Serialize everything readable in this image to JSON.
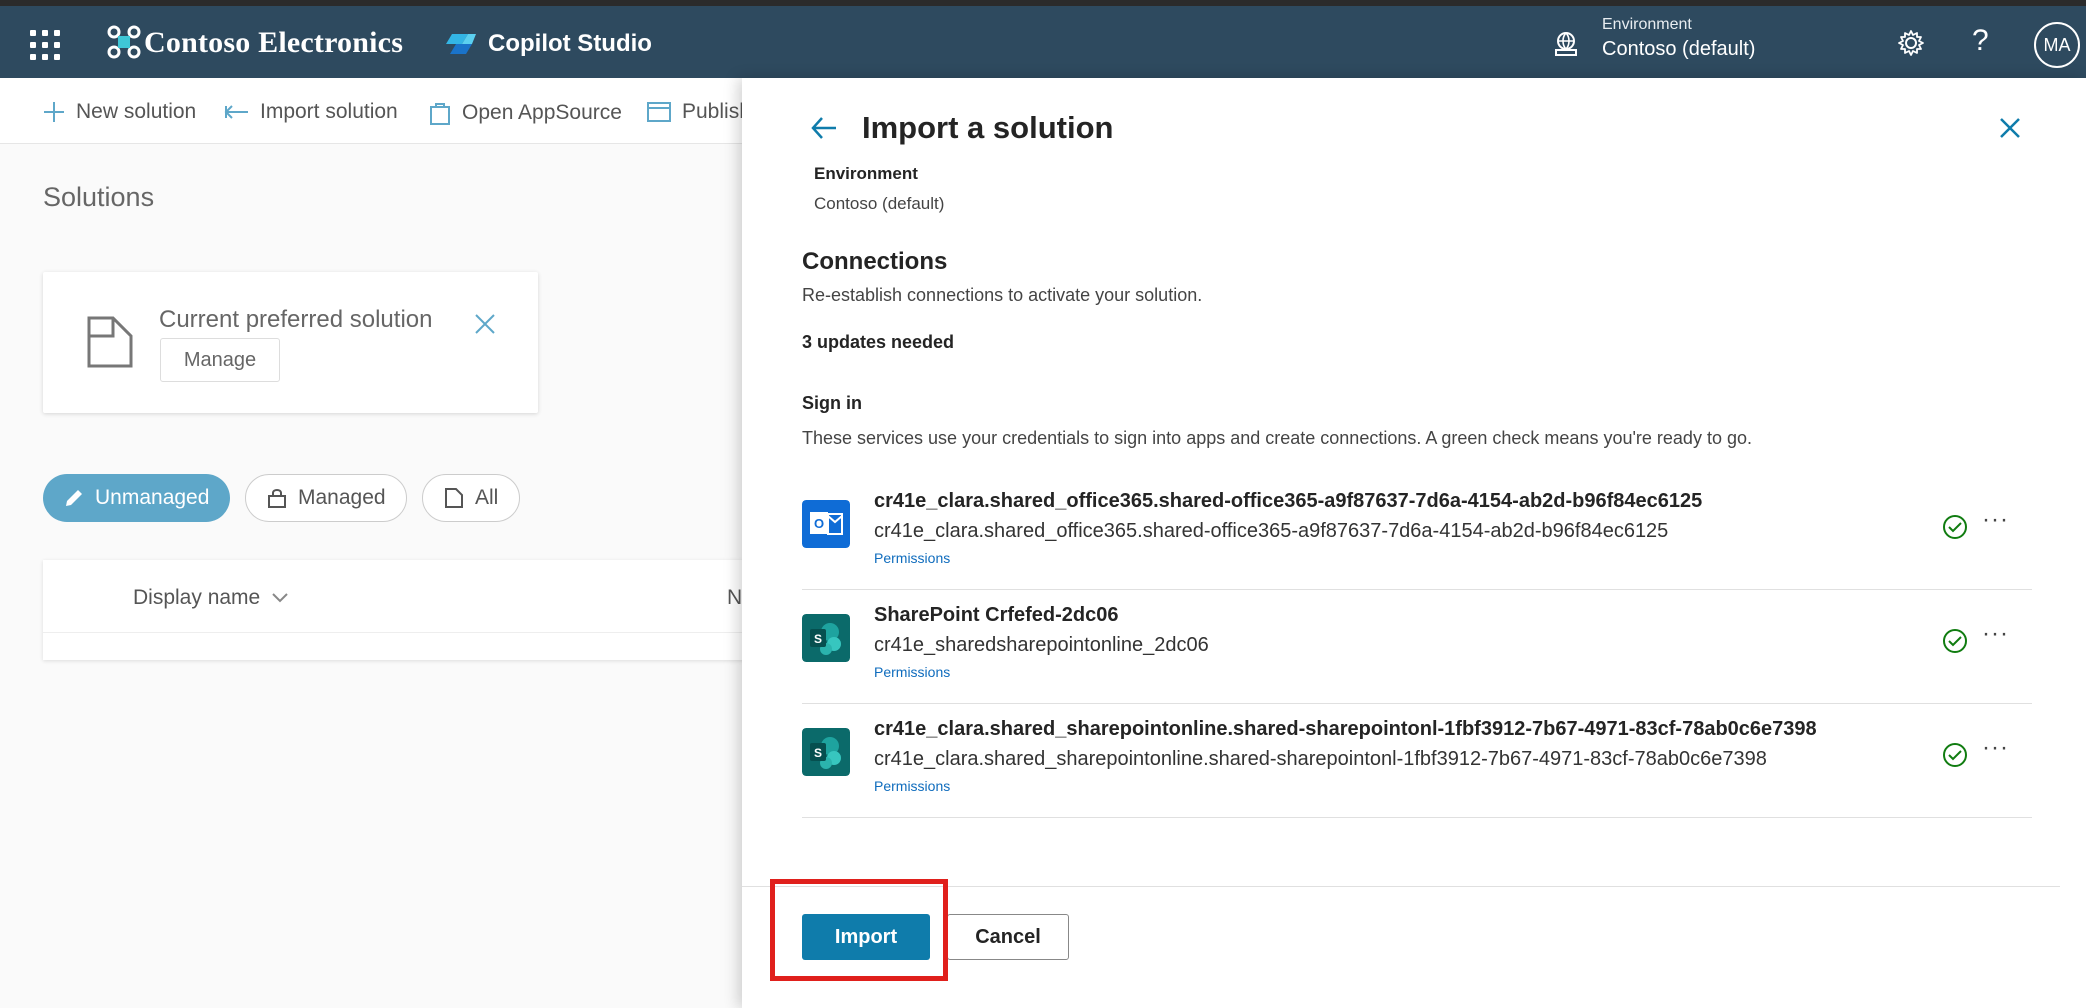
{
  "topbar": {
    "brand": "Contoso Electronics",
    "product": "Copilot Studio",
    "environment_label": "Environment",
    "environment_value": "Contoso (default)",
    "help": "?",
    "avatar": "MA"
  },
  "commands": {
    "new_solution": "New solution",
    "import_solution": "Import solution",
    "open_appsource": "Open AppSource",
    "publish": "Publish"
  },
  "page": {
    "title": "Solutions",
    "preferred_title": "Current preferred solution",
    "preferred_manage": "Manage",
    "filters": [
      "Unmanaged",
      "Managed",
      "All"
    ],
    "grid_col_display": "Display name",
    "grid_col_n": "N"
  },
  "panel": {
    "title": "Import a solution",
    "env_key": "Environment",
    "env_value": "Contoso (default)",
    "connections_heading": "Connections",
    "connections_sub": "Re-establish connections to activate your solution.",
    "updates_needed": "3 updates needed",
    "signin_heading": "Sign in",
    "signin_desc": "These services use your credentials to sign into apps and create connections. A green check means you're ready to go.",
    "rows": [
      {
        "title": "cr41e_clara.shared_office365.shared-office365-a9f87637-7d6a-4154-ab2d-b96f84ec6125",
        "sub": "cr41e_clara.shared_office365.shared-office365-a9f87637-7d6a-4154-ab2d-b96f84ec6125",
        "perm": "Permissions",
        "icon": "outlook-icon"
      },
      {
        "title": "SharePoint Crfefed-2dc06",
        "sub": "cr41e_sharedsharepointonline_2dc06",
        "perm": "Permissions",
        "icon": "sharepoint-icon"
      },
      {
        "title": "cr41e_clara.shared_sharepointonline.shared-sharepointonl-1fbf3912-7b67-4971-83cf-78ab0c6e7398",
        "sub": "cr41e_clara.shared_sharepointonline.shared-sharepointonl-1fbf3912-7b67-4971-83cf-78ab0c6e7398",
        "perm": "Permissions",
        "icon": "sharepoint-icon"
      }
    ],
    "more": "···",
    "import_button": "Import",
    "cancel_button": "Cancel"
  },
  "colors": {
    "topbar": "#2e4a5f",
    "accent": "#0f7cab",
    "highlight": "#e0201c",
    "check": "#107c10"
  }
}
